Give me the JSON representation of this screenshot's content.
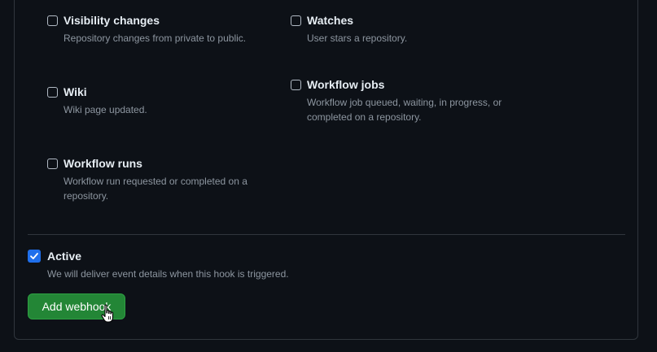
{
  "events": {
    "visibility": {
      "title": "Visibility changes",
      "desc": "Repository changes from private to public."
    },
    "watches": {
      "title": "Watches",
      "desc": "User stars a repository."
    },
    "wiki": {
      "title": "Wiki",
      "desc": "Wiki page updated."
    },
    "workflow_jobs": {
      "title": "Workflow jobs",
      "desc": "Workflow job queued, waiting, in progress, or completed on a repository."
    },
    "workflow_runs": {
      "title": "Workflow runs",
      "desc": "Workflow run requested or completed on a repository."
    }
  },
  "active": {
    "label": "Active",
    "desc": "We will deliver event details when this hook is triggered.",
    "checked": true
  },
  "submit_label": "Add webhook",
  "colors": {
    "background": "#0d1117",
    "accent_checkbox": "#1f6feb",
    "button": "#238636"
  },
  "icons": [
    "check-icon",
    "hand-pointer-cursor-icon"
  ]
}
